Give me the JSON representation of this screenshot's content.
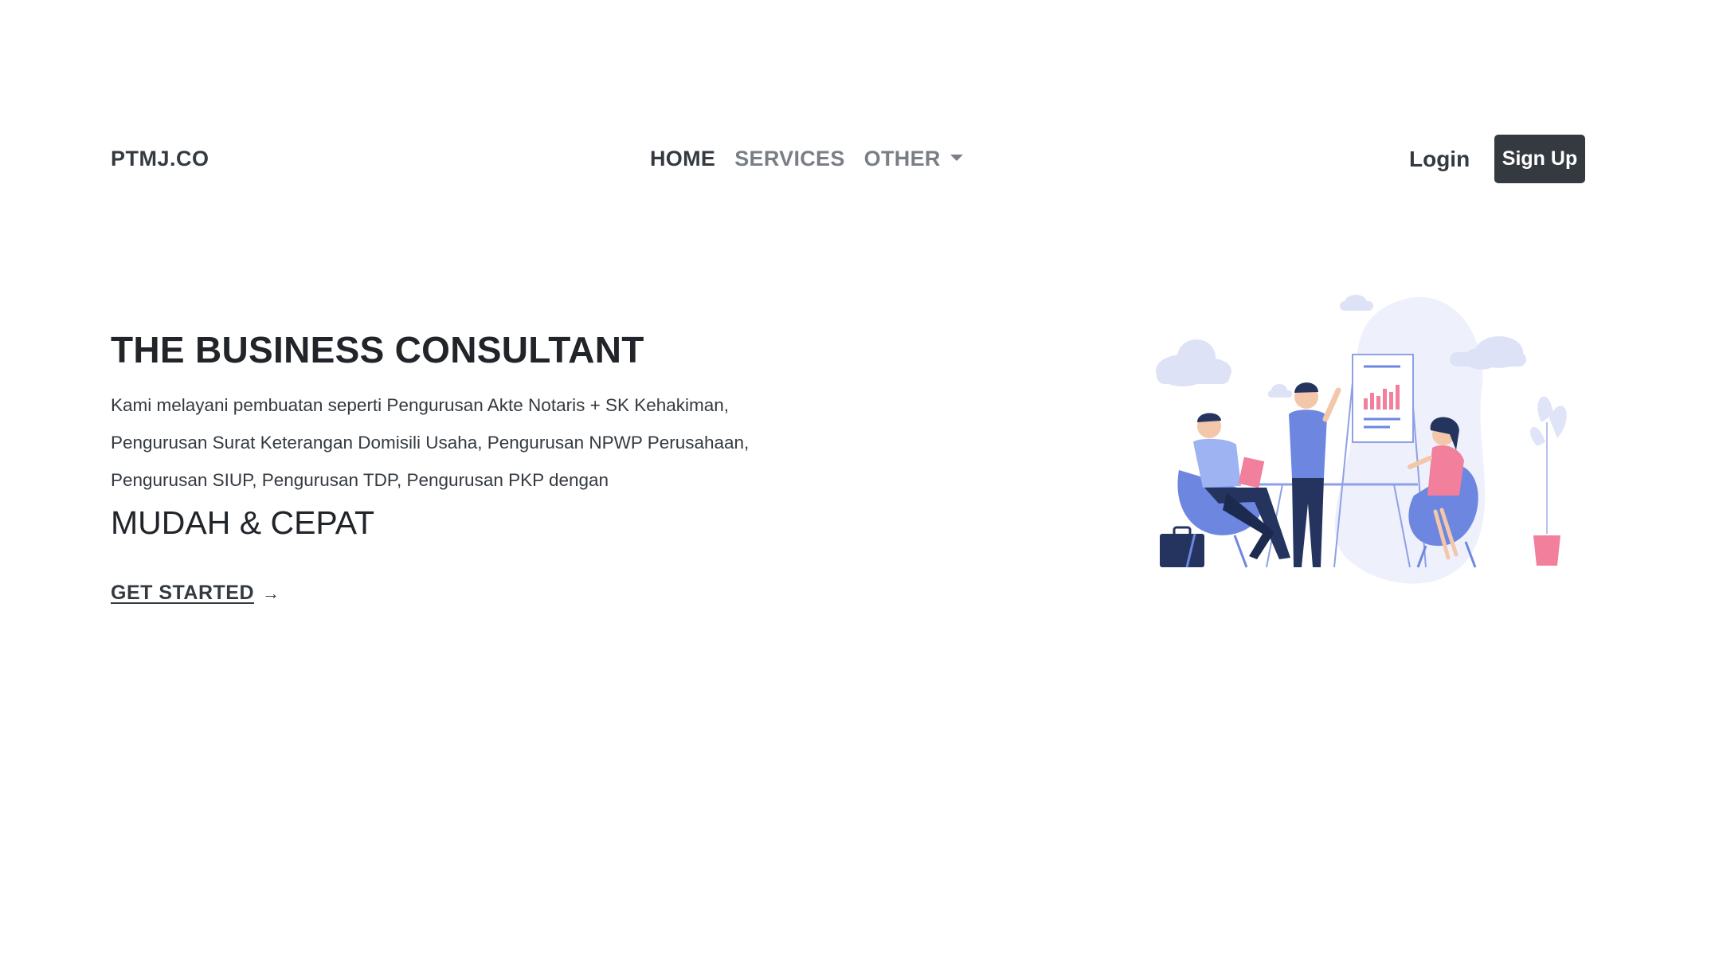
{
  "navbar": {
    "brand": "PTMJ.CO",
    "links": [
      {
        "label": "HOME",
        "active": true
      },
      {
        "label": "SERVICES",
        "active": false
      },
      {
        "label": "OTHER",
        "active": false,
        "dropdown": true
      }
    ],
    "login_label": "Login",
    "signup_label": "Sign Up"
  },
  "hero": {
    "title": "THE BUSINESS CONSULTANT",
    "description": "Kami melayani pembuatan seperti Pengurusan Akte Notaris + SK Kehakiman, Pengurusan Surat Keterangan Domisili Usaha, Pengurusan NPWP Perusahaan, Pengurusan SIUP, Pengurusan TDP, Pengurusan PKP dengan",
    "subtitle": "MUDAH & CEPAT",
    "cta_label": "GET STARTED",
    "cta_arrow": "→"
  },
  "colors": {
    "dark": "#343a40",
    "muted": "#7a7f85",
    "illus_blue": "#6d86e0",
    "illus_light": "#e9ecfb",
    "illus_navy": "#25345e",
    "illus_pink": "#f27f9b"
  },
  "icons": {
    "dropdown": "caret-down-icon",
    "cta_arrow": "arrow-right-icon"
  }
}
